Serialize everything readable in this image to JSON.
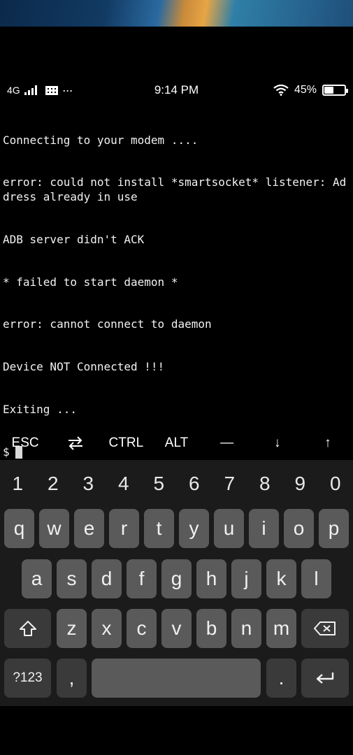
{
  "status_bar": {
    "network": "4G",
    "time": "9:14 PM",
    "battery_text": "45%",
    "battery_level": 0.45,
    "dots": "···"
  },
  "terminal": {
    "lines": [
      "Connecting to your modem ....",
      "error: could not install *smartsocket* listener: Address already in use",
      "ADB server didn't ACK",
      "* failed to start daemon *",
      "error: cannot connect to daemon",
      "Device NOT Connected !!!",
      "Exiting ..."
    ],
    "prompt": "$"
  },
  "extra_keys": [
    {
      "label": "ESC",
      "name": "esc-key"
    },
    {
      "label": "⇄",
      "name": "tab-key"
    },
    {
      "label": "CTRL",
      "name": "ctrl-key"
    },
    {
      "label": "ALT",
      "name": "alt-key"
    },
    {
      "label": "—",
      "name": "dash-key"
    },
    {
      "label": "↓",
      "name": "arrow-down-key"
    },
    {
      "label": "↑",
      "name": "arrow-up-key"
    }
  ],
  "keyboard": {
    "numbers": [
      "1",
      "2",
      "3",
      "4",
      "5",
      "6",
      "7",
      "8",
      "9",
      "0"
    ],
    "row1": [
      "q",
      "w",
      "e",
      "r",
      "t",
      "y",
      "u",
      "i",
      "o",
      "p"
    ],
    "row2": [
      "a",
      "s",
      "d",
      "f",
      "g",
      "h",
      "j",
      "k",
      "l"
    ],
    "row3": [
      "z",
      "x",
      "c",
      "v",
      "b",
      "n",
      "m"
    ],
    "symbols_label": "?123",
    "comma": ",",
    "period": ".",
    "shift_icon": "shift-icon",
    "backspace_icon": "backspace-icon",
    "enter_icon": "enter-icon"
  }
}
